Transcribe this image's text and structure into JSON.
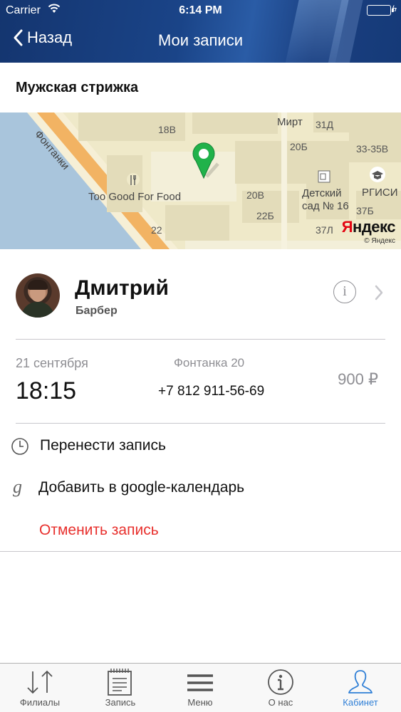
{
  "status_bar": {
    "carrier": "Carrier",
    "time": "6:14 PM"
  },
  "nav": {
    "back_label": "Назад",
    "title": "Мои записи"
  },
  "service": {
    "title": "Мужская стрижка"
  },
  "map": {
    "labels": {
      "street": "Фонтанки",
      "b18v": "18В",
      "mirt": "Мирт",
      "b31d": "31Д",
      "b20b": "20Б",
      "b33": "33-35В",
      "restaurant": "Too Good For Food",
      "b20v": "20В",
      "kindergarten": "Детский\nсад № 16",
      "rgisi": "РГИСИ",
      "b22b": "22Б",
      "b37b": "37Б",
      "b22": "22",
      "b37l": "37Л"
    },
    "logo_text": "Яндекс",
    "copyright": "© Яндекс"
  },
  "barber": {
    "name": "Дмитрий",
    "role": "Барбер"
  },
  "booking": {
    "date": "21 сентября",
    "time": "18:15",
    "address": "Фонтанка 20",
    "phone": "+7 812 911-56-69",
    "price": "900 ₽"
  },
  "actions": {
    "reschedule": "Перенести запись",
    "add_calendar": "Добавить в google-календарь",
    "cancel": "Отменить запись"
  },
  "tabs": [
    {
      "label": "Филиалы",
      "icon": "sort-arrows-icon"
    },
    {
      "label": "Запись",
      "icon": "document-icon"
    },
    {
      "label": "Меню",
      "icon": "menu-icon"
    },
    {
      "label": "О нас",
      "icon": "info-icon"
    },
    {
      "label": "Кабинет",
      "icon": "user-icon"
    }
  ],
  "colors": {
    "accent": "#2f7fd6",
    "danger": "#e8302d",
    "header": "#1a4488",
    "battery": "#4cd964"
  }
}
